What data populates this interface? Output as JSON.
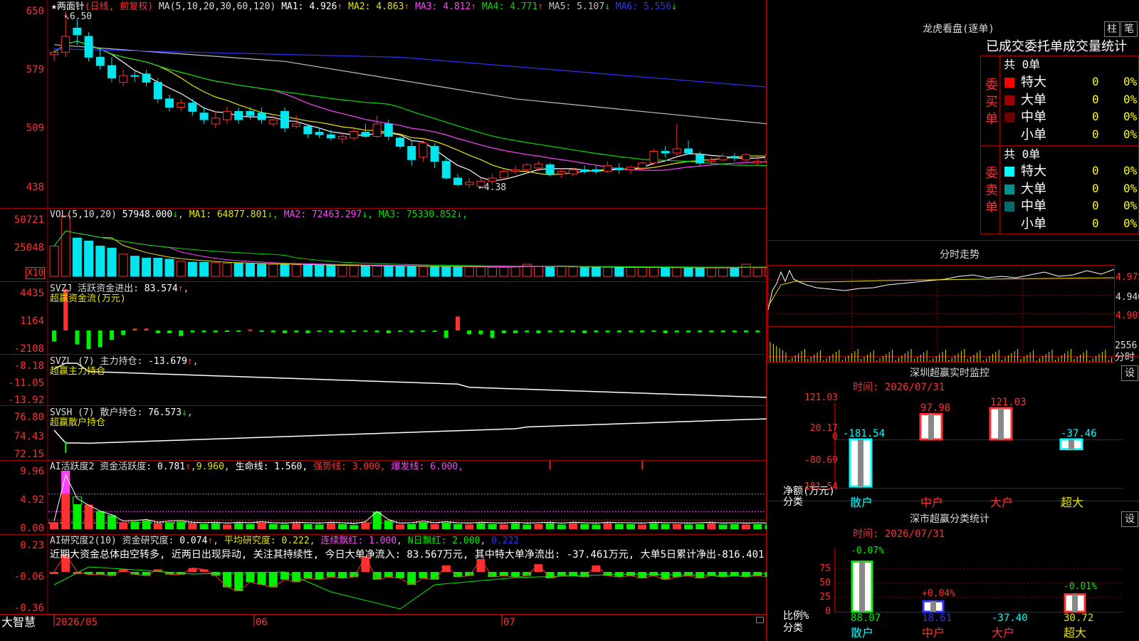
{
  "colors": {
    "up": "#ff3030",
    "down": "#00e5ee",
    "frame": "#a00000",
    "ma1": "#ffffff",
    "ma2": "#e5e500",
    "ma3": "#ff40ff",
    "ma4": "#00dd00",
    "ma5": "#c0c0c0",
    "ma6": "#3030ff"
  },
  "kline": {
    "star": "★",
    "name": "两面针",
    "period": "(日线, 前复权)",
    "ma_params": "MA(5,10,20,30,60,120)",
    "ma": [
      {
        "label": "MA1: 4.926",
        "arrow": "↑"
      },
      {
        "label": "MA2: 4.863",
        "arrow": "↑"
      },
      {
        "label": "MA3: 4.812",
        "arrow": "↑"
      },
      {
        "label": "MA4: 4.771",
        "arrow": "↑"
      },
      {
        "label": "MA5: 5.107",
        "arrow": "↓"
      },
      {
        "label": "MA6: 5.556",
        "arrow": "↓"
      }
    ],
    "y_ticks": [
      "650",
      "579",
      "509",
      "438"
    ],
    "high_marker": "6.50",
    "low_marker": "4.38",
    "candles": [
      [
        5.98,
        6.05,
        5.9,
        6.01
      ],
      [
        6.01,
        6.5,
        5.95,
        6.2
      ],
      [
        6.3,
        6.4,
        6.1,
        6.22
      ],
      [
        6.2,
        6.25,
        5.9,
        5.95
      ],
      [
        5.95,
        6.05,
        5.8,
        5.85
      ],
      [
        5.85,
        5.95,
        5.65,
        5.7
      ],
      [
        5.65,
        5.8,
        5.6,
        5.73
      ],
      [
        5.73,
        5.8,
        5.65,
        5.72
      ],
      [
        5.75,
        5.8,
        5.6,
        5.65
      ],
      [
        5.65,
        5.7,
        5.4,
        5.45
      ],
      [
        5.45,
        5.5,
        5.3,
        5.35
      ],
      [
        5.35,
        5.45,
        5.3,
        5.4
      ],
      [
        5.4,
        5.45,
        5.25,
        5.3
      ],
      [
        5.28,
        5.35,
        5.15,
        5.2
      ],
      [
        5.15,
        5.3,
        5.1,
        5.22
      ],
      [
        5.2,
        5.35,
        5.15,
        5.3
      ],
      [
        5.3,
        5.35,
        5.15,
        5.2
      ],
      [
        5.3,
        5.35,
        5.2,
        5.25
      ],
      [
        5.28,
        5.35,
        5.15,
        5.2
      ],
      [
        5.15,
        5.25,
        5.12,
        5.2
      ],
      [
        5.3,
        5.35,
        5.05,
        5.1
      ],
      [
        5.12,
        5.25,
        5.1,
        5.15
      ],
      [
        5.12,
        5.15,
        4.98,
        5.03
      ],
      [
        5.05,
        5.1,
        4.98,
        5.02
      ],
      [
        5.02,
        5.08,
        4.95,
        4.98
      ],
      [
        4.97,
        5.05,
        4.92,
        5.0
      ],
      [
        4.98,
        5.1,
        4.95,
        5.06
      ],
      [
        5.05,
        5.15,
        4.98,
        5.0
      ],
      [
        5.0,
        5.25,
        4.98,
        5.15
      ],
      [
        5.15,
        5.2,
        4.95,
        5.0
      ],
      [
        4.98,
        5.0,
        4.85,
        4.88
      ],
      [
        4.88,
        4.95,
        4.65,
        4.72
      ],
      [
        4.75,
        4.95,
        4.7,
        4.92
      ],
      [
        4.88,
        4.92,
        4.62,
        4.7
      ],
      [
        4.7,
        4.75,
        4.48,
        4.5
      ],
      [
        4.5,
        4.55,
        4.4,
        4.42
      ],
      [
        4.42,
        4.5,
        4.38,
        4.45
      ],
      [
        4.4,
        4.5,
        4.38,
        4.46
      ],
      [
        4.46,
        4.55,
        4.42,
        4.5
      ],
      [
        4.5,
        4.6,
        4.48,
        4.58
      ],
      [
        4.58,
        4.65,
        4.55,
        4.6
      ],
      [
        4.6,
        4.68,
        4.56,
        4.66
      ],
      [
        4.62,
        4.7,
        4.58,
        4.67
      ],
      [
        4.66,
        4.68,
        4.52,
        4.55
      ],
      [
        4.55,
        4.62,
        4.5,
        4.58
      ],
      [
        4.55,
        4.62,
        4.52,
        4.6
      ],
      [
        4.6,
        4.65,
        4.55,
        4.58
      ],
      [
        4.6,
        4.65,
        4.55,
        4.58
      ],
      [
        4.58,
        4.7,
        4.56,
        4.65
      ],
      [
        4.62,
        4.68,
        4.55,
        4.6
      ],
      [
        4.6,
        4.65,
        4.55,
        4.63
      ],
      [
        4.62,
        4.7,
        4.6,
        4.68
      ],
      [
        4.68,
        4.85,
        4.65,
        4.82
      ],
      [
        4.82,
        4.88,
        4.75,
        4.8
      ],
      [
        4.8,
        5.15,
        4.75,
        4.85
      ],
      [
        4.85,
        4.95,
        4.78,
        4.8
      ],
      [
        4.78,
        4.82,
        4.65,
        4.68
      ],
      [
        4.7,
        4.75,
        4.65,
        4.72
      ],
      [
        4.72,
        4.8,
        4.7,
        4.76
      ],
      [
        4.76,
        4.8,
        4.7,
        4.74
      ],
      [
        4.72,
        4.8,
        4.68,
        4.78
      ],
      [
        4.68,
        4.76,
        4.64,
        4.7
      ],
      [
        4.7,
        4.8,
        4.66,
        4.78
      ],
      [
        4.78,
        4.88,
        4.72,
        4.84
      ],
      [
        4.84,
        4.9,
        4.78,
        4.8
      ],
      [
        4.8,
        4.95,
        4.76,
        4.82
      ],
      [
        4.82,
        4.98,
        4.8,
        4.93
      ]
    ]
  },
  "vol": {
    "label": "VOL(5,10,20)",
    "value": "57948.000",
    "value_arrow": "↓",
    "ma": [
      {
        "label": "MA1: 64877.801",
        "arrow": "↓"
      },
      {
        "label": "MA2: 72463.297",
        "arrow": "↓"
      },
      {
        "label": "MA3: 75330.852",
        "arrow": "↓"
      }
    ],
    "y_ticks": [
      "50721",
      "25048"
    ],
    "unit": "X10",
    "values": [
      30000,
      60000,
      38000,
      35000,
      30000,
      28000,
      22000,
      20000,
      18000,
      18000,
      17000,
      15000,
      14000,
      14000,
      13500,
      13000,
      13000,
      12500,
      12000,
      12000,
      12000,
      11500,
      11000,
      11000,
      11000,
      10800,
      10500,
      10500,
      10300,
      10000,
      10000,
      10000,
      9800,
      9500,
      9600,
      9800,
      9500,
      9300,
      9000,
      9000,
      9500,
      12000,
      10000,
      9500,
      9800,
      9200,
      9300,
      9000,
      9000,
      9000,
      8800,
      8800,
      8700,
      8700,
      8600,
      8500,
      8500,
      8400,
      8400,
      8500,
      12000,
      8500,
      8400,
      8000,
      8000,
      8200,
      8300,
      8000,
      9000,
      8500,
      9000,
      9500,
      8800,
      10000,
      12000,
      12500,
      13000,
      11000,
      10000,
      9500,
      9200,
      9800,
      12000,
      10000,
      9500,
      9200,
      12000,
      10000,
      9800,
      9600,
      9500,
      9400,
      9300,
      9200,
      9000,
      8800,
      8500,
      8000,
      8200,
      12000,
      11000,
      9500
    ]
  },
  "svzj": {
    "label": "SVZJ  活跃资金进出:",
    "value": "83.574",
    "value_arrow": "↑",
    "sub": "超赢资金流(万元)",
    "y_ticks": [
      "4435",
      "1164",
      "-2108"
    ],
    "values": [
      -1200,
      4435,
      -1500,
      -2000,
      -1800,
      -1000,
      -500,
      200,
      200,
      -300,
      -300,
      -600,
      -200,
      -200,
      -200,
      -100,
      -100,
      100,
      -100,
      -200,
      -300,
      -200,
      -300,
      -100,
      -200,
      -200,
      -100,
      -100,
      -200,
      -300,
      -100,
      -200,
      -100,
      -100,
      -800,
      1500,
      -400,
      -400,
      -800,
      -300,
      -300,
      -200,
      -300,
      -200,
      -200,
      -200,
      -300,
      -200,
      -200,
      -200,
      -200,
      -200,
      -100,
      -300,
      -200,
      -200,
      -200,
      -200,
      -200,
      -200,
      -200,
      -200,
      -300,
      -300,
      -300,
      -300,
      -300,
      -300,
      -300,
      -300,
      -300,
      -300,
      -300,
      -300,
      -300,
      -300,
      -300,
      -300,
      -300,
      -300,
      -300,
      -300,
      -300,
      -300,
      -300,
      -300,
      -300,
      -300,
      -300,
      -300,
      -300,
      -300,
      -300,
      -300,
      -300,
      -300,
      -300,
      -300,
      -300,
      -300,
      -300,
      -300,
      -300,
      -300,
      -800,
      -300
    ]
  },
  "svzl": {
    "label": "SVZL (7) 主力持仓:",
    "value": "-13.679",
    "value_arrow": "↑",
    "sub": "超赢主力持仓",
    "y_ticks": [
      "-8.18",
      "-11.05",
      "-13.92"
    ]
  },
  "svsh": {
    "label": "SVSH (7) 散户持仓:",
    "value": "76.573",
    "value_arrow": "↓",
    "sub": "超赢散户持仓",
    "y_ticks": [
      "76.80",
      "74.43",
      "72.15"
    ]
  },
  "ai_active": {
    "label": "AI活跃度2 资金活跃度:",
    "value": "0.781",
    "value_arrow": "↑",
    "value2": "9.960",
    "lifeline": "生命线: 1.560,",
    "strong": "强势线: 3.000,",
    "burst": "爆发线: 6.000,",
    "y_ticks": [
      "9.96",
      "4.92",
      "0.00"
    ]
  },
  "ai_research": {
    "label": "AI研究度2(10) 资金研究度:",
    "value": "0.074",
    "value_arrow": "↑",
    "avg": "平均研究度: 0.222",
    "consec": "连续飘红: 1.000",
    "n_days": "N日飘红: 2.000",
    "last": "0.222",
    "comment": "近期大资金总体由空转多, 近两日出现异动, 关注其持续性, 今日大单净流入: 83.567万元, 其中特大单净流出: -37.461万元, 大单5日累计净出-816.401",
    "y_ticks": [
      "0.23",
      "-0.06",
      "-0.36"
    ]
  },
  "bottom": {
    "brand": "大智慧",
    "dates": [
      "2026/05",
      "06",
      "07"
    ]
  },
  "lhkp": {
    "title": "龙虎看盘(逐单)",
    "btn_zhu": "柱",
    "btn_bi": "笔",
    "subtitle": "已成交委托单成交量统计",
    "buy_label": "委买单",
    "sell_label": "委卖单",
    "buy_total": "共 0单",
    "sell_total": "共 0单",
    "buy_rows": [
      {
        "label": "特大",
        "count": "0",
        "pct": "0%",
        "color": "#ff0000"
      },
      {
        "label": "大单",
        "count": "0",
        "pct": "0%",
        "color": "#a00000"
      },
      {
        "label": "中单",
        "count": "0",
        "pct": "0%",
        "color": "#700000"
      },
      {
        "label": "小单",
        "count": "0",
        "pct": "0%",
        "color": ""
      }
    ],
    "sell_rows": [
      {
        "label": "特大",
        "count": "0",
        "pct": "0%",
        "color": "#00ffff"
      },
      {
        "label": "大单",
        "count": "0",
        "pct": "0%",
        "color": "#009090"
      },
      {
        "label": "中单",
        "count": "0",
        "pct": "0%",
        "color": "#006a6a"
      },
      {
        "label": "小单",
        "count": "0",
        "pct": "0%",
        "color": ""
      }
    ]
  },
  "minute": {
    "title": "分时走势",
    "y_ticks": [
      "4.975",
      "4.940",
      "4.905"
    ],
    "vol_tick": "2556",
    "vol_label": "分时"
  },
  "sz_monitor": {
    "title": "深圳超赢实时监控",
    "set_btn": "设",
    "time": "时间: 2026/07/31",
    "y_ticks": [
      "121.03",
      "20.17",
      "0",
      "-80.69",
      "-181.54"
    ],
    "y_unit": "净额(万元)",
    "cat_label": "分类",
    "categories": [
      "散户",
      "中户",
      "大户",
      "超大"
    ],
    "values": [
      -181.54,
      97.98,
      121.03,
      -37.46
    ],
    "value_labels": [
      "-181.54",
      "97.98",
      "121.03",
      "-37.46"
    ]
  },
  "sz_class": {
    "title": "深市超赢分类统计",
    "set_btn": "设",
    "time": "时间: 2026/07/31",
    "y_ticks": [
      "75",
      "50",
      "25",
      "0"
    ],
    "y_unit": "比例%",
    "cat_label": "分类",
    "categories": [
      "散户",
      "中户",
      "大户",
      "超大"
    ],
    "pct_labels": [
      "-0.07%",
      "+0.04%",
      "",
      "-0.01%"
    ],
    "pct_values": [
      88.07,
      18.61,
      0,
      30.72
    ],
    "values": [
      "88.07",
      "18.61",
      "-37.40",
      "30.72"
    ]
  }
}
